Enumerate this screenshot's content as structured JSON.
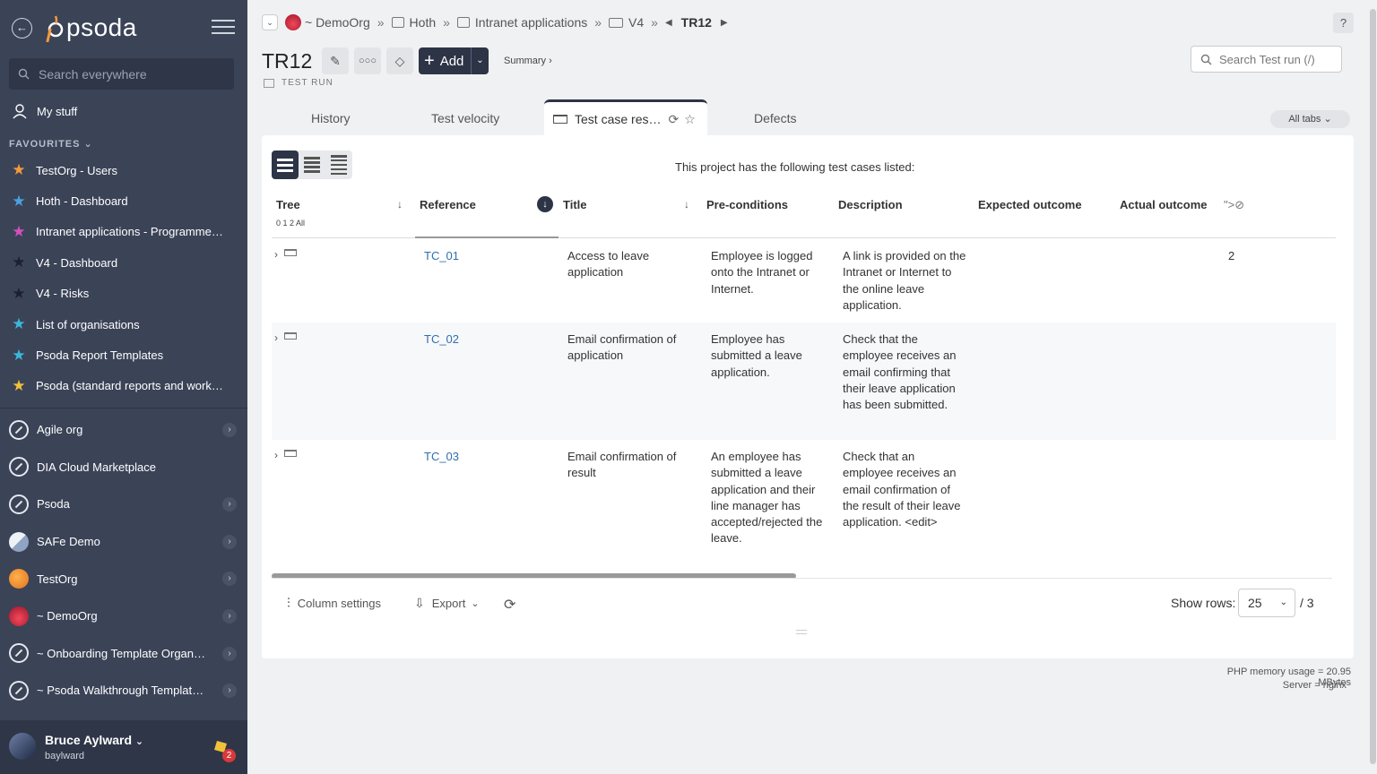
{
  "sidebar": {
    "logo_text": "psoda",
    "search_placeholder": "Search everywhere",
    "my_stuff": "My stuff",
    "favourites_label": "FAVOURITES",
    "favourites": [
      {
        "label": "TestOrg - Users",
        "color": "#f39a3c"
      },
      {
        "label": "Hoth - Dashboard",
        "color": "#4aa3e0"
      },
      {
        "label": "Intranet applications - Programme…",
        "color": "#d74fc1"
      },
      {
        "label": "V4 - Dashboard",
        "color": "#2a2f3d"
      },
      {
        "label": "V4 - Risks",
        "color": "#2a2f3d"
      },
      {
        "label": "List of organisations",
        "color": "#3bb8d9"
      },
      {
        "label": "Psoda Report Templates",
        "color": "#3bb8d9"
      },
      {
        "label": "Psoda (standard reports and work…",
        "color": "#f0c23a"
      }
    ],
    "organisations": [
      {
        "label": "Agile org",
        "icon": "rocket",
        "chevron": true
      },
      {
        "label": "DIA Cloud Marketplace",
        "icon": "rocket",
        "chevron": false
      },
      {
        "label": "Psoda",
        "icon": "rocket",
        "chevron": true
      },
      {
        "label": "SAFe Demo",
        "icon": "safe",
        "chevron": true
      },
      {
        "label": "TestOrg",
        "icon": "orange",
        "chevron": true
      },
      {
        "label": "~ DemoOrg",
        "icon": "sunset",
        "chevron": true
      },
      {
        "label": "~ Onboarding Template Organisa…",
        "icon": "rocket",
        "chevron": true
      },
      {
        "label": "~ Psoda Walkthrough Template P…",
        "icon": "rocket",
        "chevron": true
      }
    ],
    "user": {
      "name": "Bruce Aylward",
      "login": "baylward",
      "notifications": "2"
    }
  },
  "breadcrumb": {
    "items": [
      "~ DemoOrg",
      "Hoth",
      "Intranet applications",
      "V4"
    ],
    "separator": "»",
    "current": "TR12"
  },
  "page": {
    "title": "TR12",
    "type_label": "TEST RUN",
    "add_label": "Add",
    "summary_label": "Summary ›",
    "search_placeholder": "Search Test run (/)",
    "help": "?"
  },
  "tabs": {
    "items": [
      "History",
      "Test velocity",
      "Defects"
    ],
    "active": "Test case res…",
    "all_tabs": "All tabs"
  },
  "panel": {
    "intro": "This project has the following test cases listed:",
    "columns": {
      "tree": "Tree",
      "tree_levels": "0 1 2 All",
      "reference": "Reference",
      "title": "Title",
      "preconditions": "Pre-conditions",
      "description": "Description",
      "expected": "Expected outcome",
      "actual": "Actual outcome",
      "extra": "\">"
    },
    "rows": [
      {
        "ref": "TC_01",
        "title": "Access to leave application",
        "pre": "Employee is logged onto the Intranet or Internet.",
        "desc": "A link is provided on the Intranet or Internet to the online leave application.",
        "extra": "2"
      },
      {
        "ref": "TC_02",
        "title": "Email confirmation of application",
        "pre": "Employee has submitted a leave application.",
        "desc": "Check that the employee receives an email confirming that their leave application has been submitted.",
        "extra": ""
      },
      {
        "ref": "TC_03",
        "title": "Email confirmation of result",
        "pre": "An employee has submitted a leave application and their line manager has accepted/rejected the leave.",
        "desc": "Check that an employee receives an email confirmation of the result of their leave application. <edit>",
        "extra": ""
      }
    ],
    "footer": {
      "column_settings": "Column settings",
      "export": "Export",
      "show_rows_label": "Show rows:",
      "rows_value": "25",
      "rows_total": "/ 3"
    }
  },
  "server": {
    "memory": "PHP memory usage = 20.95 MBytes",
    "server": "Server = nginx"
  },
  "colors": {
    "sidebar_bg": "#3b4357",
    "accent": "#2d3446",
    "link": "#2f6fb0"
  }
}
